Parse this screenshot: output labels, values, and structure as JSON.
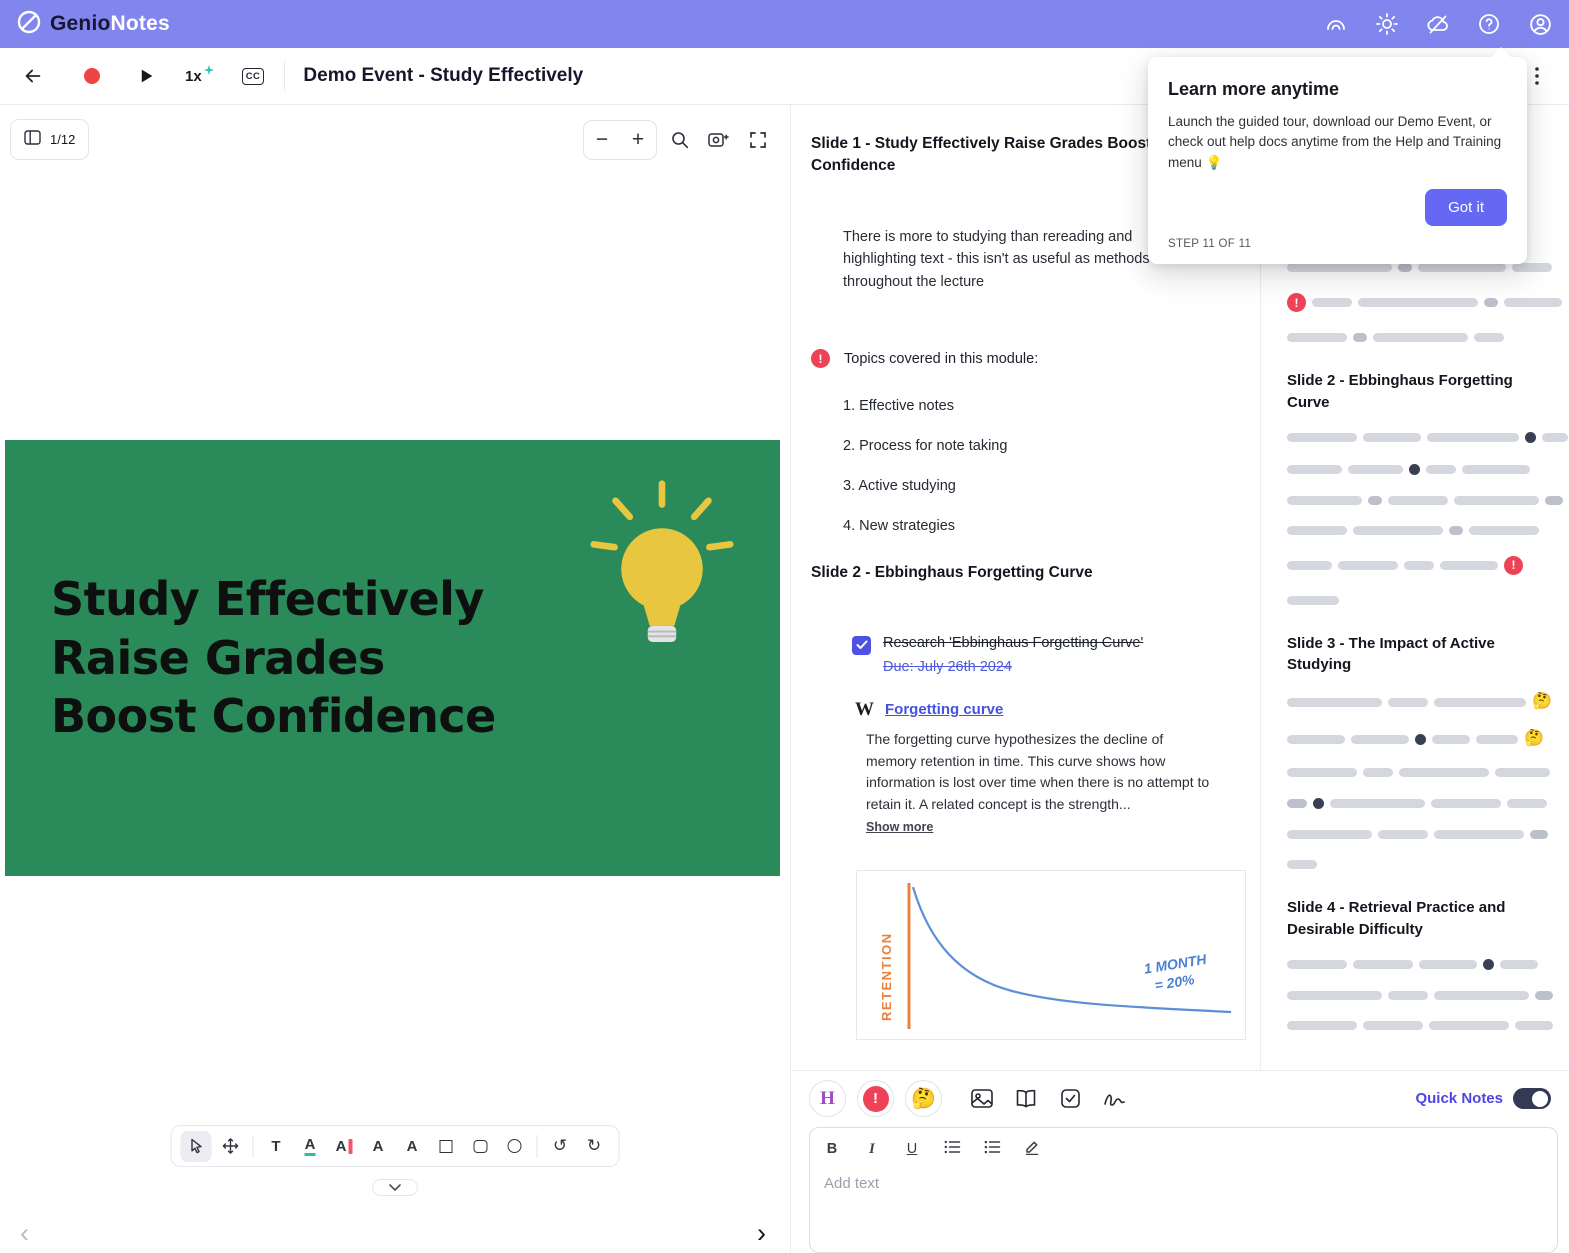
{
  "header": {
    "brand_bold": "Genio",
    "brand_light": "Notes"
  },
  "playback": {
    "speed": "1x",
    "cc_label": "CC",
    "title": "Demo Event - Study Effectively"
  },
  "viewer": {
    "page_indicator": "1/12",
    "slide": {
      "line1": "Study Effectively",
      "line2": "Raise Grades",
      "line3": "Boost Confidence"
    }
  },
  "notes": {
    "slide1_heading": "Slide 1 - Study Effectively Raise Grades Boost Confidence",
    "slide1_paragraph": "There is more to studying than rereading and highlighting text - this isn't as useful as methods used throughout the lecture",
    "topics_label": "Topics covered in this module:",
    "topics": [
      "1. Effective notes",
      "2. Process for note taking",
      "3. Active studying",
      "4. New strategies"
    ],
    "slide2_heading": "Slide 2 - Ebbinghaus Forgetting Curve",
    "task_text": "Research 'Ebbinghaus Forgetting Curve'",
    "task_due": "Due: July 26th 2024",
    "wiki_glyph": "W",
    "wiki_link": "Forgetting curve",
    "wiki_excerpt": "The forgetting curve hypothesizes the decline of memory retention in time. This curve shows how information is lost over time when there is no attempt to retain it. A related concept is the strength...",
    "show_more": "Show more",
    "chart": {
      "y_label": "RETENTION",
      "annotation_line1": "1 MONTH",
      "annotation_line2": "= 20%"
    }
  },
  "outline": {
    "sections": [
      {
        "title": "",
        "rows": [
          [
            105,
            14,
            88,
            40
          ],
          [
            "alert",
            40,
            120,
            14,
            58
          ],
          [
            60,
            14,
            95,
            30
          ]
        ]
      },
      {
        "title": "Slide 2 - Ebbinghaus Forgetting Curve",
        "rows": [
          [
            70,
            58,
            92,
            "dot",
            26
          ],
          [
            55,
            55,
            "dot",
            30,
            68
          ],
          [
            75,
            14,
            60,
            85,
            18
          ],
          [
            60,
            90,
            14,
            70
          ],
          [
            45,
            60,
            30,
            58,
            "alert"
          ],
          [
            52
          ]
        ]
      },
      {
        "title": "Slide 3 - The Impact of Active Studying",
        "rows": [
          [
            95,
            40,
            92,
            "emoji:🤔"
          ],
          [
            58,
            58,
            "dot",
            38,
            42,
            "emoji:🤔"
          ],
          [
            70,
            30,
            90,
            55
          ],
          [
            20,
            "dot",
            95,
            70,
            40
          ],
          [
            85,
            50,
            90,
            18
          ],
          [
            30
          ]
        ]
      },
      {
        "title": "Slide 4 - Retrieval Practice and Desirable Difficulty",
        "rows": [
          [
            60,
            60,
            58,
            "dot",
            38
          ],
          [
            95,
            40,
            95,
            18
          ],
          [
            70,
            60,
            80,
            38
          ]
        ]
      }
    ]
  },
  "popup": {
    "title": "Learn more anytime",
    "body": "Launch the guided tour, download our Demo Event, or check out help docs anytime from the Help and Training menu 💡",
    "button_label": "Got it",
    "step_label": "STEP 11 OF 11"
  },
  "editor": {
    "quick_notes_label": "Quick Notes",
    "quick_notes_on": true,
    "placeholder": "Add text",
    "highlight_letter": "H",
    "format_bold": "B",
    "format_italic": "I",
    "format_underline": "U"
  }
}
